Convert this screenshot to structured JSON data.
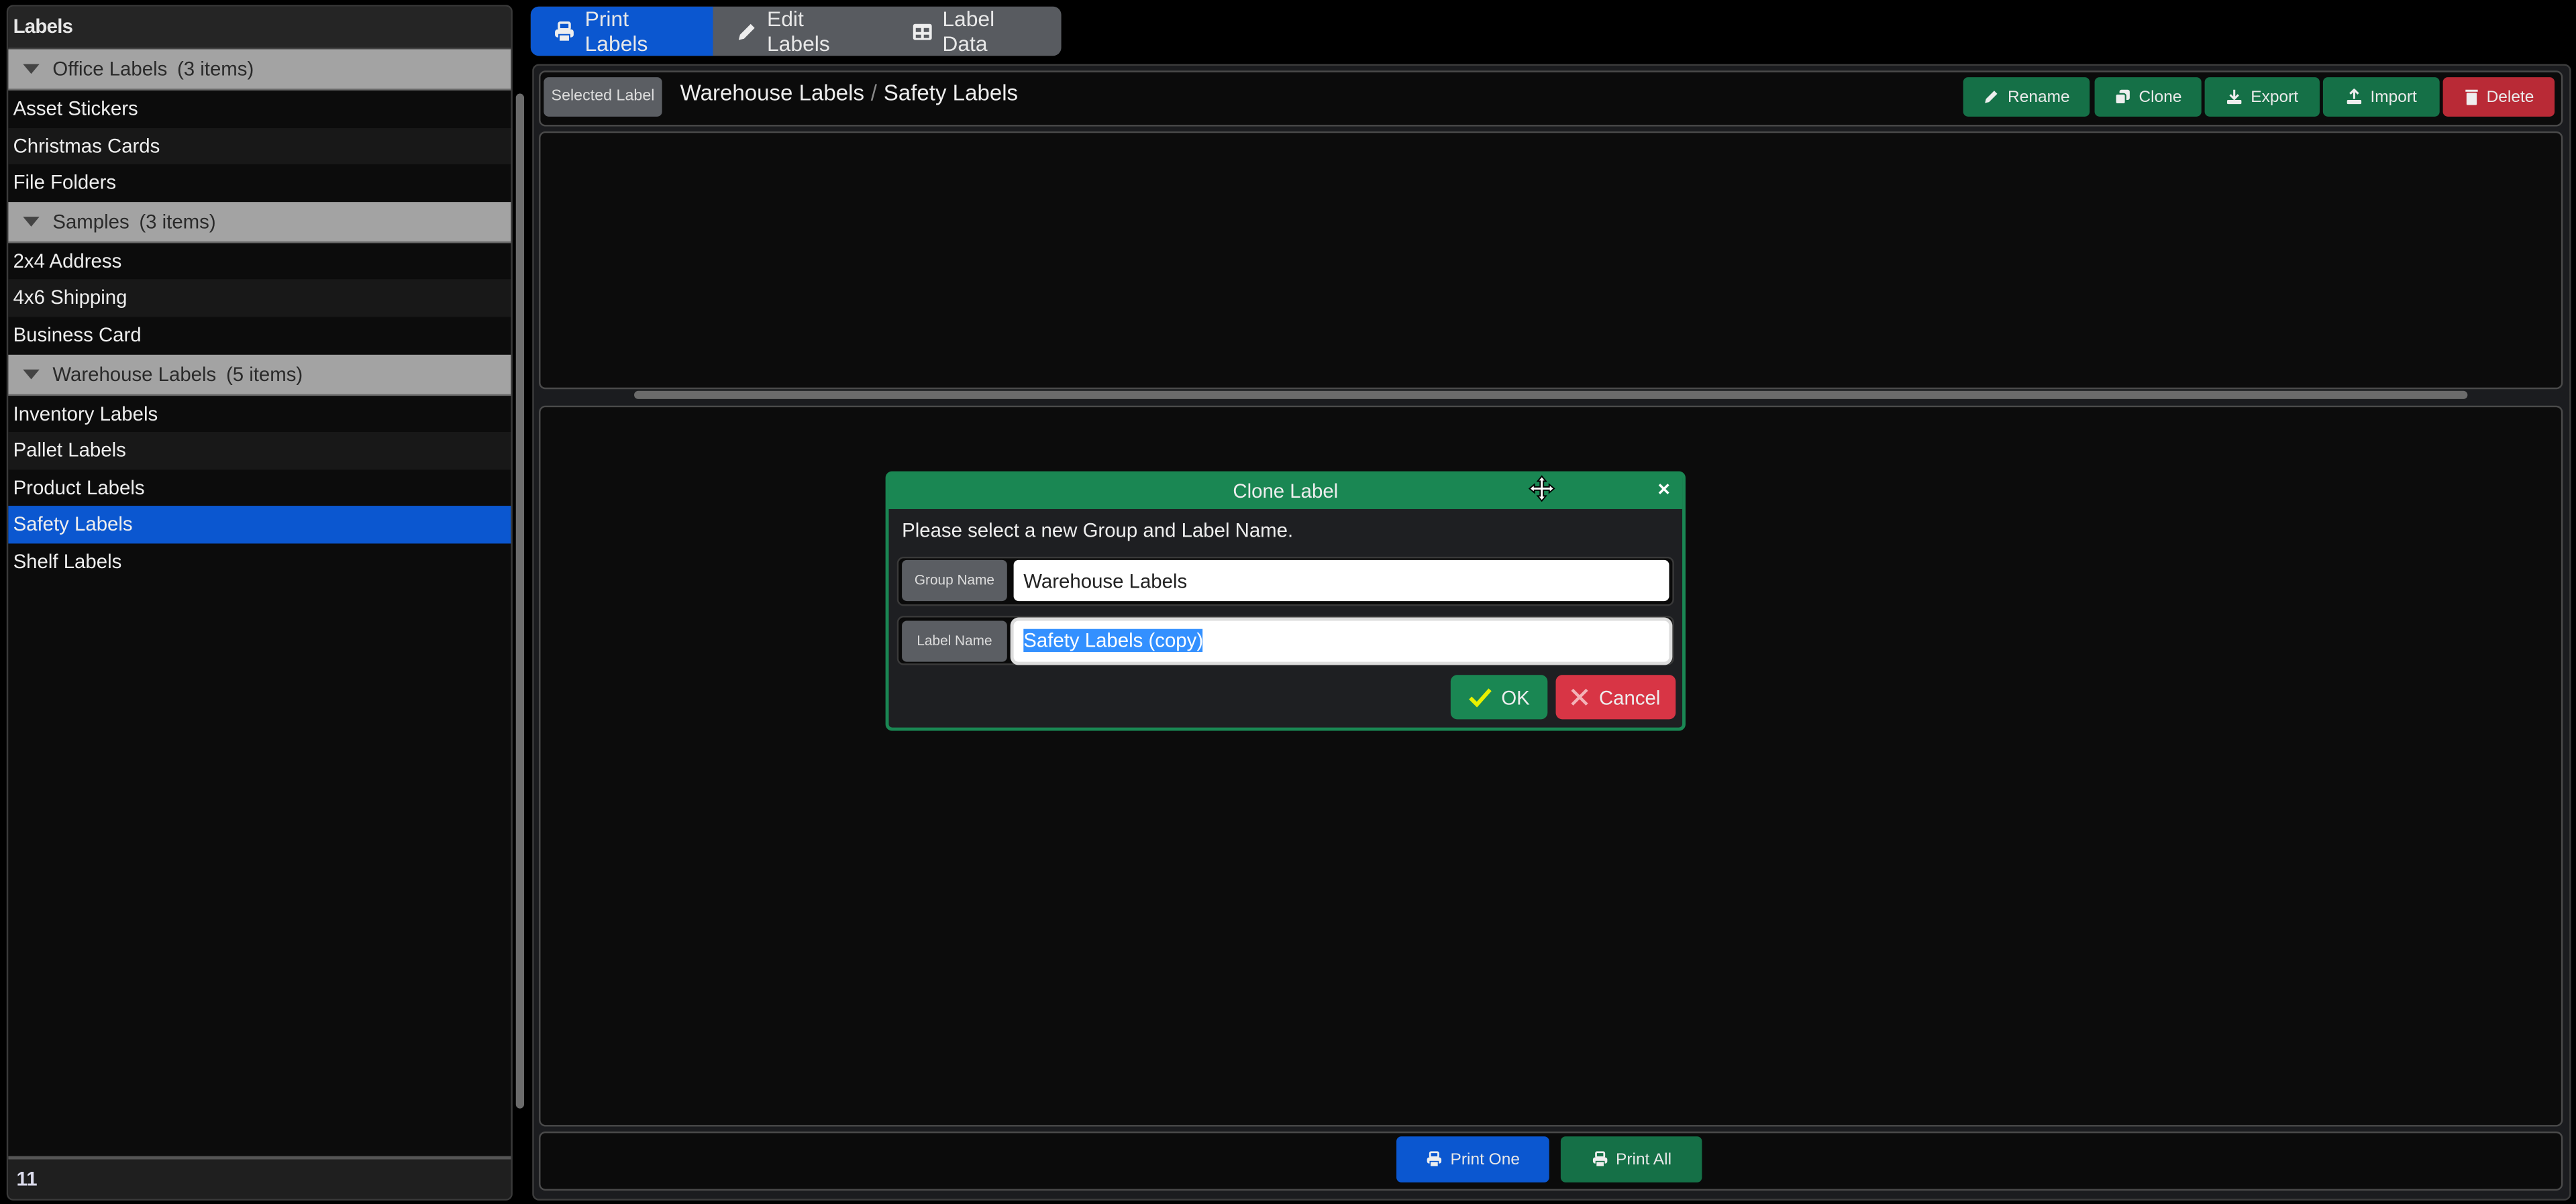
{
  "sidebar": {
    "title": "Labels",
    "groups": [
      {
        "name": "Office Labels",
        "count": "(3 items)",
        "items": [
          "Asset Stickers",
          "Christmas Cards",
          "File Folders"
        ]
      },
      {
        "name": "Samples",
        "count": "(3 items)",
        "items": [
          "2x4 Address",
          "4x6 Shipping",
          "Business Card"
        ]
      },
      {
        "name": "Warehouse Labels",
        "count": "(5 items)",
        "items": [
          "Inventory Labels",
          "Pallet Labels",
          "Product Labels",
          "Safety Labels",
          "Shelf Labels"
        ]
      }
    ],
    "selected_item": "Safety Labels",
    "footer_count": "11"
  },
  "tabs": [
    {
      "label": "Print Labels",
      "icon": "printer-icon",
      "active": true
    },
    {
      "label": "Edit Labels",
      "icon": "pencil-icon",
      "active": false
    },
    {
      "label": "Label Data",
      "icon": "table-icon",
      "active": false
    }
  ],
  "header": {
    "badge": "Selected Label",
    "group": "Warehouse Labels",
    "separator": "/",
    "label": "Safety Labels",
    "buttons": [
      {
        "label": "Rename",
        "icon": "pencil-icon",
        "color": "#157047"
      },
      {
        "label": "Clone",
        "icon": "copy-icon",
        "color": "#157047"
      },
      {
        "label": "Export",
        "icon": "download-icon",
        "color": "#157047"
      },
      {
        "label": "Import",
        "icon": "upload-icon",
        "color": "#157047"
      },
      {
        "label": "Delete",
        "icon": "trash-icon",
        "color": "#b92a36"
      }
    ]
  },
  "footer": {
    "print_one": "Print One",
    "print_all": "Print All"
  },
  "dialog": {
    "title": "Clone Label",
    "close": "×",
    "message": "Please select a new Group and Label Name.",
    "group_label": "Group Name",
    "group_value": "Warehouse Labels",
    "label_label": "Label Name",
    "label_value": "Safety Labels (copy)",
    "ok": "OK",
    "cancel": "Cancel"
  },
  "colors": {
    "accent_blue": "#0b57d0",
    "success_green": "#157047",
    "dialog_green": "#1a8753",
    "danger_red": "#b92a36"
  }
}
